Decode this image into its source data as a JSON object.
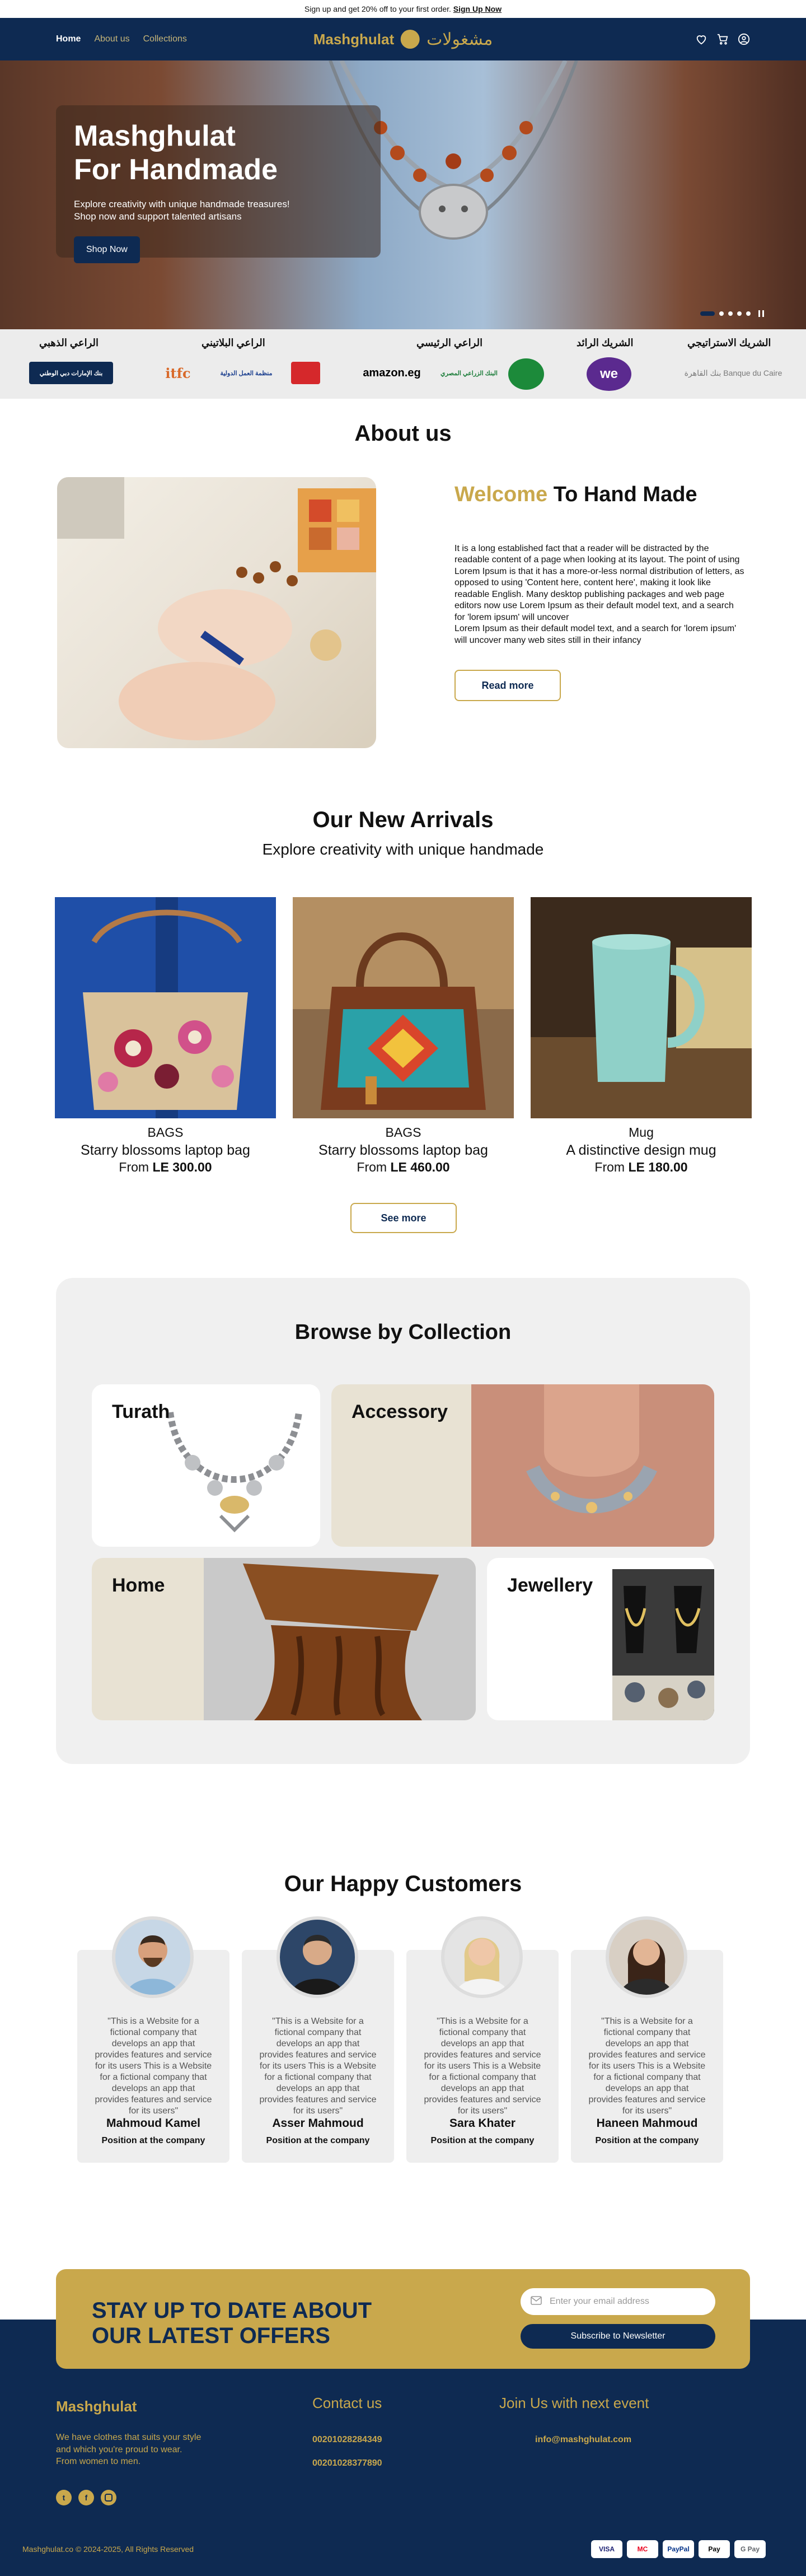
{
  "topbar": {
    "text": "Sign up and get 20% off to your first order.",
    "link": "Sign Up Now"
  },
  "nav": {
    "links": [
      "Home",
      "About us",
      "Collections"
    ],
    "logo_text": "Mashghulat",
    "logo_arabic": "مشغولات"
  },
  "hero": {
    "title": "Mashghulat\nFor Handmade",
    "subtitle": "Explore creativity with unique handmade treasures!\nShop now and support talented artisans",
    "button": "Shop Now"
  },
  "sponsors": {
    "labels": [
      "الراعي الذهبي",
      "الراعي البلاتيني",
      "الراعي الرئيسي",
      "الشريك الرائد",
      "الشريك الاستراتيجي"
    ],
    "logos": [
      "بنك الإمارات دبي الوطني",
      "itfc",
      "منظمة العمل الدولية",
      "",
      "amazon.eg",
      "البنك الزراعي المصري",
      "",
      "we",
      "بنك القاهرة Banque du Caire"
    ]
  },
  "about": {
    "heading": "About us",
    "title_gold": "Welcome",
    "title_rest": " To Hand Made",
    "text": "It is a long established fact that a reader will be distracted by the readable content of a page when looking at its layout. The point of using Lorem Ipsum is that it has a more-or-less normal distribution of letters, as opposed to using 'Content here, content here', making it look like readable English. Many desktop publishing packages and web page editors now use Lorem Ipsum as their default model text, and a search for 'lorem ipsum' will uncover\nLorem Ipsum as their default model text, and a search for 'lorem ipsum' will uncover many web sites still in their infancy",
    "button": "Read more"
  },
  "arrivals": {
    "heading": "Our New Arrivals",
    "subheading": "Explore creativity with unique handmade",
    "products": [
      {
        "category": "BAGS",
        "name": "Starry blossoms laptop bag",
        "price_prefix": "From ",
        "price": "LE 300.00"
      },
      {
        "category": "BAGS",
        "name": "Starry blossoms laptop bag",
        "price_prefix": "From ",
        "price": "LE 460.00"
      },
      {
        "category": "Mug",
        "name": "A distinctive design mug",
        "price_prefix": "From ",
        "price": "LE 180.00"
      }
    ],
    "button": "See more"
  },
  "collections": {
    "heading": "Browse by Collection",
    "items": [
      "Turath",
      "Accessory",
      "Home",
      "Jewellery"
    ]
  },
  "customers": {
    "heading": "Our  Happy Customers",
    "list": [
      {
        "quote": "\"This is a Website for a fictional company that develops an app that provides features and service for its users This is a Website for a fictional company that develops an app that provides features and service for its users\"",
        "name": "Mahmoud Kamel",
        "role": "Position at the company"
      },
      {
        "quote": "\"This is a Website for a fictional company that develops an app that provides features and service for its users This is a Website for a fictional company that develops an app that provides features and service for its users\"",
        "name": "Asser Mahmoud",
        "role": "Position at the company"
      },
      {
        "quote": "\"This is a Website for a fictional company that develops an app that provides features and service for its users This is a Website for a fictional company that develops an app that provides features and service for its users\"",
        "name": "Sara Khater",
        "role": "Position at the company"
      },
      {
        "quote": "\"This is a Website for a fictional company that develops an app that provides features and service for its users This is a Website for a fictional company that develops an app that provides features and service for its users\"",
        "name": "Haneen Mahmoud",
        "role": "Position at the company"
      }
    ]
  },
  "newsletter": {
    "title": "STAY UP TO DATE ABOUT\nOUR LATEST OFFERS",
    "placeholder": "Enter your email address",
    "button": "Subscribe to Newsletter"
  },
  "footer": {
    "brand": "Mashghulat",
    "tagline": "We have clothes that suits your style and which you're proud to wear. From women to men.",
    "contact_title": "Contact us",
    "phones": [
      "00201028284349",
      "00201028377890"
    ],
    "event_title": "Join Us with next event",
    "email": "info@mashghulat.com",
    "copyright": "Mashghulat.co © 2024-2025, All Rights Reserved",
    "payments": [
      "VISA",
      "MC",
      "PayPal",
      "Pay",
      "G Pay"
    ]
  },
  "colors": {
    "navy": "#0e2a52",
    "gold": "#c9a84c",
    "light_gray": "#f0f0f0"
  }
}
